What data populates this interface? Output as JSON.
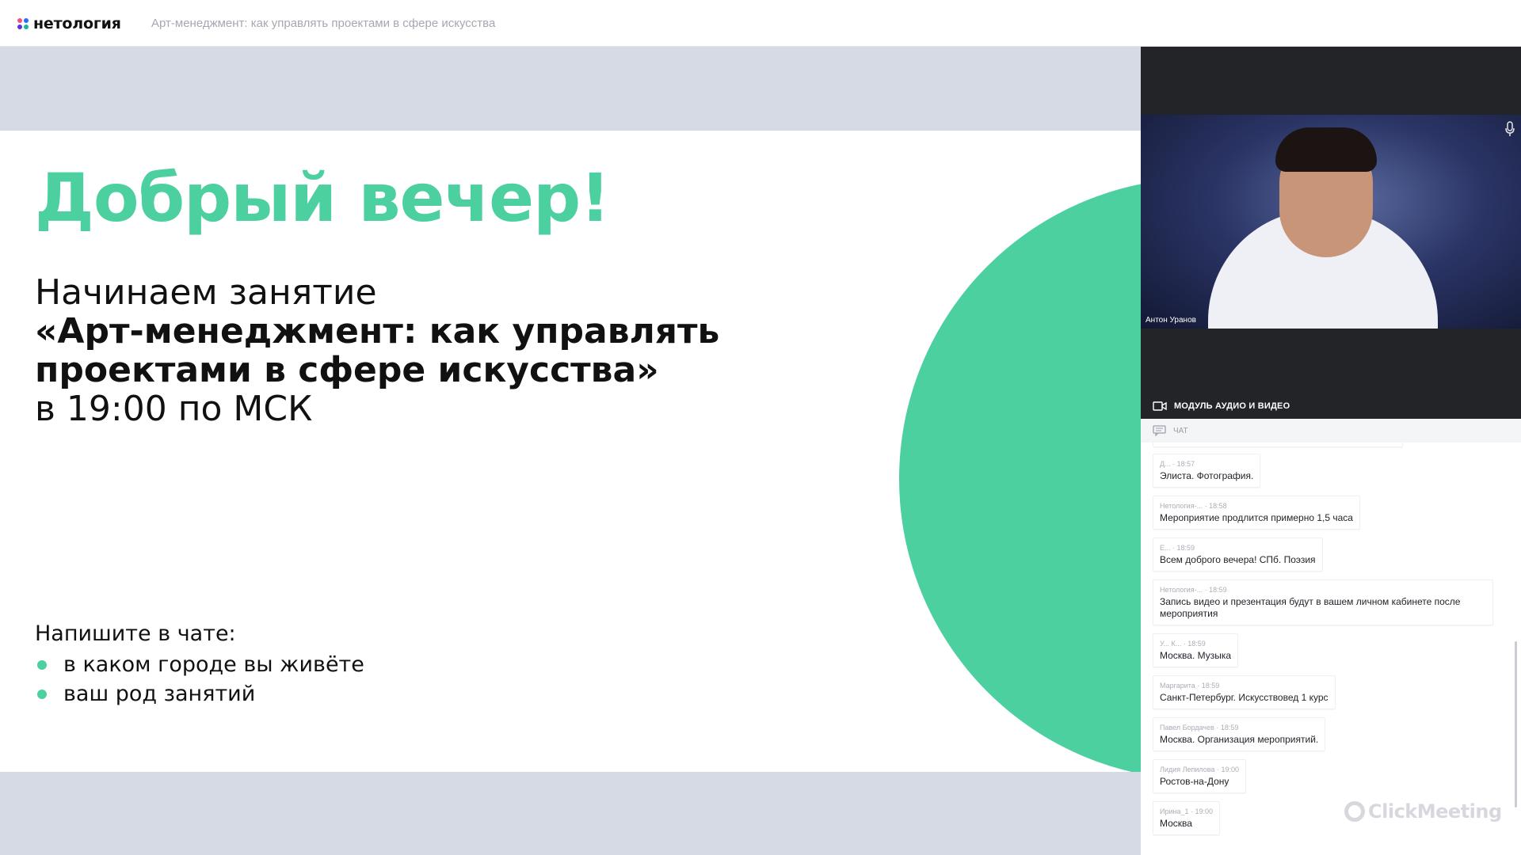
{
  "app": {
    "logo_text": "нетология",
    "course_title": "Арт-менеджмент: как управлять проектами в сфере искусства"
  },
  "slide": {
    "greeting": "Добрый вечер!",
    "intro_line1": "Начинаем занятие",
    "intro_line2": "«Арт-менеджмент: как управлять",
    "intro_line3": "проектами в сфере искусства»",
    "intro_line4": "в 19:00 по МСК",
    "chat_prompt": "Напишите в чате:",
    "bullets": [
      "в каком городе вы живёте",
      "ваш род занятий"
    ],
    "accent_color": "#4cd09f"
  },
  "video": {
    "speaker_name": "Антон Уранов",
    "module_label": "МОДУЛЬ АУДИО И ВИДЕО"
  },
  "chat": {
    "header_label": "ЧАТ",
    "messages": [
      {
        "author": "Д...",
        "time": "18:57",
        "text": "Элиста. Фотография."
      },
      {
        "author": "Нетология-...",
        "time": "18:58",
        "text": "Мероприятие продлится примерно 1,5  часа"
      },
      {
        "author": "Е...",
        "time": "18:59",
        "text": "Всем доброго вечера! СПб. Поэзия"
      },
      {
        "author": "Нетология-...",
        "time": "18:59",
        "text": "Запись видео и презентация будут в вашем личном кабинете после мероприятия"
      },
      {
        "author": "У... К...",
        "time": "18:59",
        "text": "Москва. Музыка"
      },
      {
        "author": "Маргарита",
        "time": "18:59",
        "text": "Санкт-Петербург. Искусствовед 1 курс"
      },
      {
        "author": "Павел Бордачев",
        "time": "18:59",
        "text": "Москва. Организация мероприятий."
      },
      {
        "author": "Лидия Лепилова",
        "time": "19:00",
        "text": "Ростов-на-Дону"
      },
      {
        "author": "Ирина_1",
        "time": "19:00",
        "text": "Москва"
      }
    ]
  },
  "watermark": "ClickMeeting"
}
